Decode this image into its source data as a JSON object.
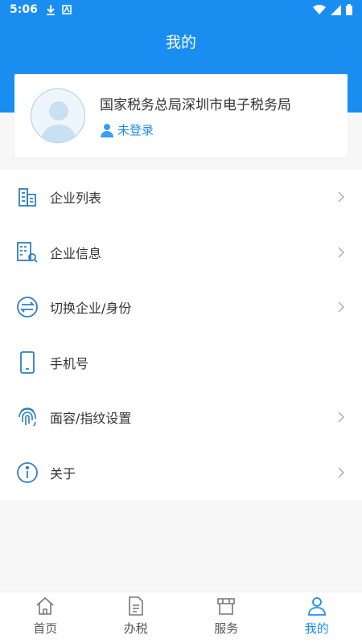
{
  "status": {
    "time": "5:06"
  },
  "header": {
    "title": "我的"
  },
  "profile": {
    "org": "国家税务总局深圳市电子税务局",
    "login_status": "未登录"
  },
  "menu": {
    "items": [
      {
        "label": "企业列表",
        "icon": "building-icon",
        "has_arrow": true
      },
      {
        "label": "企业信息",
        "icon": "company-info-icon",
        "has_arrow": true
      },
      {
        "label": "切换企业/身份",
        "icon": "switch-icon",
        "has_arrow": true
      },
      {
        "label": "手机号",
        "icon": "phone-icon",
        "has_arrow": false
      },
      {
        "label": "面容/指纹设置",
        "icon": "fingerprint-icon",
        "has_arrow": true
      },
      {
        "label": "关于",
        "icon": "info-icon",
        "has_arrow": true
      }
    ]
  },
  "nav": {
    "tabs": [
      {
        "label": "首页",
        "icon": "home-icon"
      },
      {
        "label": "办税",
        "icon": "document-icon"
      },
      {
        "label": "服务",
        "icon": "store-icon"
      },
      {
        "label": "我的",
        "icon": "user-icon",
        "active": true
      }
    ]
  },
  "colors": {
    "accent": "#1a8ef0",
    "icon": "#2d7fc0"
  }
}
